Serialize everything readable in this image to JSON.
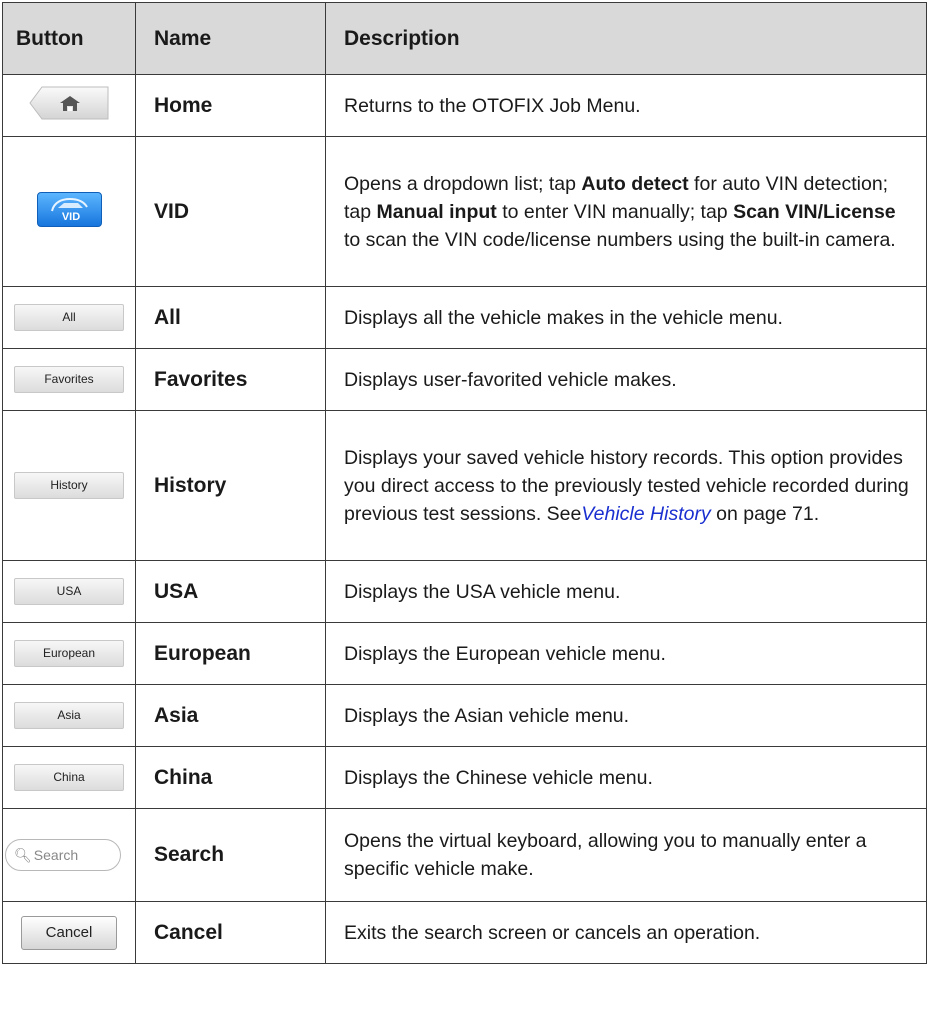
{
  "header": {
    "col_button": "Button",
    "col_name": "Name",
    "col_description": "Description"
  },
  "rows": [
    {
      "icon": "home-icon",
      "name": "Home",
      "description": "Returns to the OTOFIX Job Menu."
    },
    {
      "icon": "vid-car-icon",
      "icon_label": "VID",
      "name": "VID",
      "desc_parts": [
        "Opens a dropdown list; tap ",
        "Auto detect",
        " for auto VIN detection; tap ",
        "Manual input",
        " to enter VIN manually; tap ",
        "Scan VIN/License",
        " to scan the VIN code/license numbers using the built-in camera."
      ]
    },
    {
      "button_label": "All",
      "name": "All",
      "description": "Displays all the vehicle makes in the vehicle menu."
    },
    {
      "button_label": "Favorites",
      "name": "Favorites",
      "description": "Displays user-favorited vehicle makes."
    },
    {
      "button_label": "History",
      "name": "History",
      "desc_parts": [
        "Displays your saved vehicle history records. This option provides you direct access to the previously tested vehicle recorded during previous test sessions. See",
        "Vehicle History",
        " on page 71."
      ]
    },
    {
      "button_label": "USA",
      "name": "USA",
      "description": "Displays the USA vehicle menu."
    },
    {
      "button_label": "European",
      "name": "European",
      "description": "Displays the European vehicle menu."
    },
    {
      "button_label": "Asia",
      "name": "Asia",
      "description": "Displays the Asian vehicle menu."
    },
    {
      "button_label": "China",
      "name": "China",
      "description": "Displays the Chinese vehicle menu."
    },
    {
      "icon": "search-icon",
      "button_label": "Search",
      "name": "Search",
      "description": "Opens the virtual keyboard, allowing you to manually enter a specific vehicle make."
    },
    {
      "button_label": "Cancel",
      "name": "Cancel",
      "description": "Exits the search screen or cancels an operation."
    }
  ],
  "colors": {
    "header_bg": "#d9d9d9",
    "link": "#1a2fd0",
    "vid_button": "#1775dd"
  }
}
